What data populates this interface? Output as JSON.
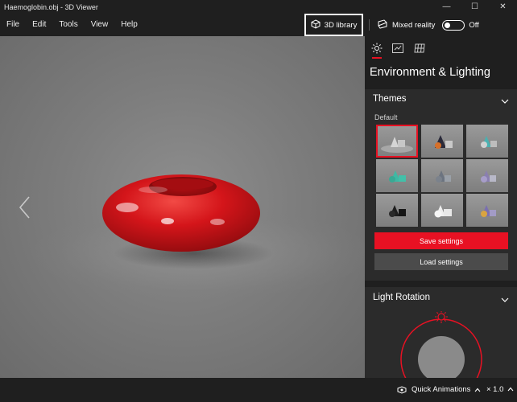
{
  "window": {
    "title": "Haemoglobin.obj - 3D Viewer",
    "controls": [
      "—",
      "☐",
      "✕"
    ]
  },
  "menu": {
    "items": [
      "File",
      "Edit",
      "Tools",
      "View",
      "Help"
    ],
    "library_label": "3D library",
    "mixed_reality_label": "Mixed reality",
    "mixed_reality_state": "Off"
  },
  "panel": {
    "tabs": [
      "sun-icon",
      "stats-icon",
      "grid-icon"
    ],
    "title": "Environment & Lighting",
    "themes": {
      "heading": "Themes",
      "selected_label": "Default",
      "save_label": "Save settings",
      "load_label": "Load settings"
    },
    "light_rotation": {
      "heading": "Light Rotation"
    }
  },
  "bottom": {
    "quick_animations_label": "Quick Animations",
    "speed": "× 1.0"
  },
  "colors": {
    "accent": "#e81123",
    "model": "#d41418",
    "panel_bg": "#2b2b2b",
    "chrome_bg": "#1f1f1f"
  }
}
